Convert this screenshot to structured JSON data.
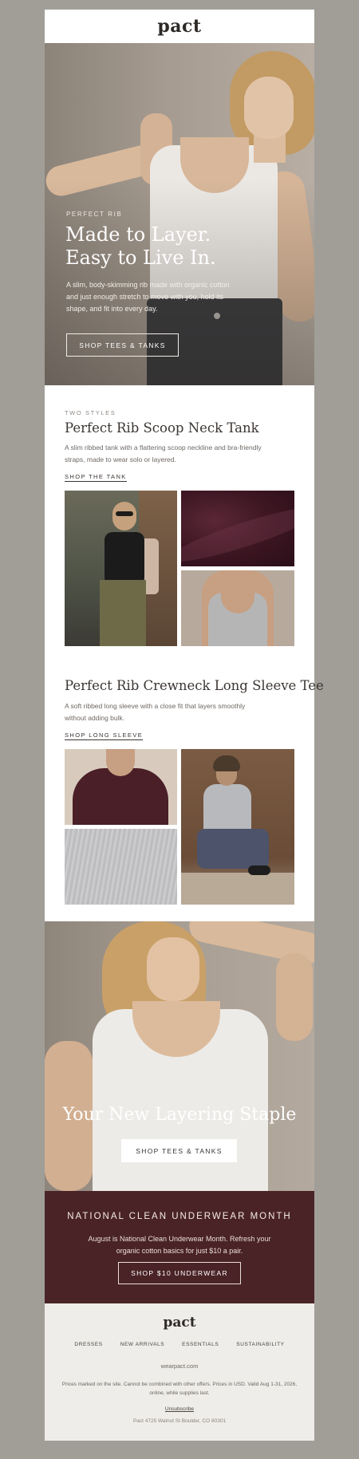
{
  "brand": {
    "logo_text": "pact"
  },
  "hero": {
    "eyebrow": "PERFECT RIB",
    "headline_line1": "Made to Layer.",
    "headline_line2": "Easy to Live In.",
    "description": "A slim, body-skimming rib made with organic cotton and just enough stretch to move with you, hold its shape, and fit into every day.",
    "cta_label": "SHOP TEES & TANKS"
  },
  "section_tank": {
    "eyebrow": "TWO STYLES",
    "title": "Perfect Rib Scoop Neck Tank",
    "description": "A slim ribbed tank with a flattering scoop neckline and bra-friendly straps, made to wear solo or layered.",
    "link_label": "SHOP THE TANK"
  },
  "section_sleeve": {
    "title": "Perfect Rib Crewneck Long Sleeve Tee",
    "description": "A soft ribbed long sleeve with a close fit that layers smoothly without adding bulk.",
    "link_label": "SHOP LONG SLEEVE"
  },
  "hero2": {
    "headline": "Your New Layering Staple",
    "cta_label": "SHOP TEES & TANKS"
  },
  "promo": {
    "title": "NATIONAL CLEAN UNDERWEAR MONTH",
    "text": "August is National Clean Underwear Month. Refresh your organic cotton basics for just $10 a pair.",
    "cta_label": "SHOP $10 UNDERWEAR"
  },
  "footer": {
    "logo_text": "pact",
    "nav": [
      "DRESSES",
      "NEW ARRIVALS",
      "ESSENTIALS",
      "SUSTAINABILITY"
    ],
    "site": "wearpact.com",
    "legal": "Prices marked on the site. Cannot be combined with other offers. Prices in USD. Valid Aug 1-31, 2026, online, while supplies last.",
    "unsubscribe": "Unsubscribe",
    "address": "Pact 4725 Walnut St Boulder, CO 80301"
  },
  "colors": {
    "page_background": "#a19e98",
    "promo_background": "#4a2326",
    "footer_background": "#efede9"
  }
}
